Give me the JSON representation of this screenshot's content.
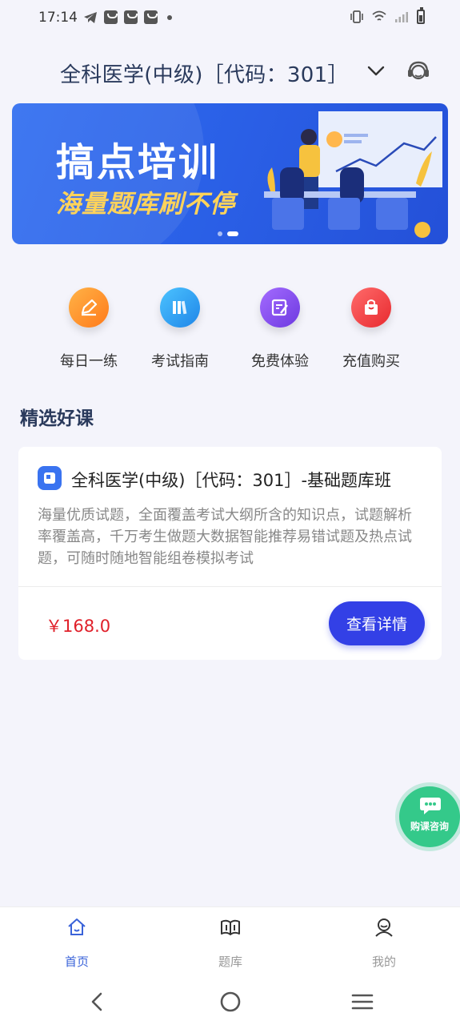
{
  "status_bar": {
    "time": "17:14"
  },
  "header": {
    "title": "全科医学(中级)［代码：301］"
  },
  "banner": {
    "title": "搞点培训",
    "subtitle": "海量题库刷不停"
  },
  "quick_actions": [
    {
      "label": "每日一练",
      "icon": "pen-icon",
      "color": "#ff8a1d"
    },
    {
      "label": "考试指南",
      "icon": "book-icon",
      "color": "#2a9af0"
    },
    {
      "label": "免费体验",
      "icon": "edit-icon",
      "color": "#8a4de8"
    },
    {
      "label": "充值购买",
      "icon": "shopping-bag-icon",
      "color": "#f0353a"
    }
  ],
  "section": {
    "title": "精选好课"
  },
  "course": {
    "title": "全科医学(中级)［代码：301］-基础题库班",
    "description": "海量优质试题，全面覆盖考试大纲所含的知识点，试题解析率覆盖高，千万考生做题大数据智能推荐易错试题及热点试题，可随时随地智能组卷模拟考试",
    "price": "￥168.0",
    "button": "查看详情"
  },
  "float_button": {
    "label": "购课咨询"
  },
  "tabs": [
    {
      "label": "首页",
      "icon": "home-icon",
      "active": true
    },
    {
      "label": "题库",
      "icon": "question-bank-icon",
      "active": false
    },
    {
      "label": "我的",
      "icon": "profile-icon",
      "active": false
    }
  ],
  "colors": {
    "accent": "#3340e6",
    "price": "#e0202a",
    "tab_active": "#3a63d9",
    "float": "#34c98a"
  }
}
